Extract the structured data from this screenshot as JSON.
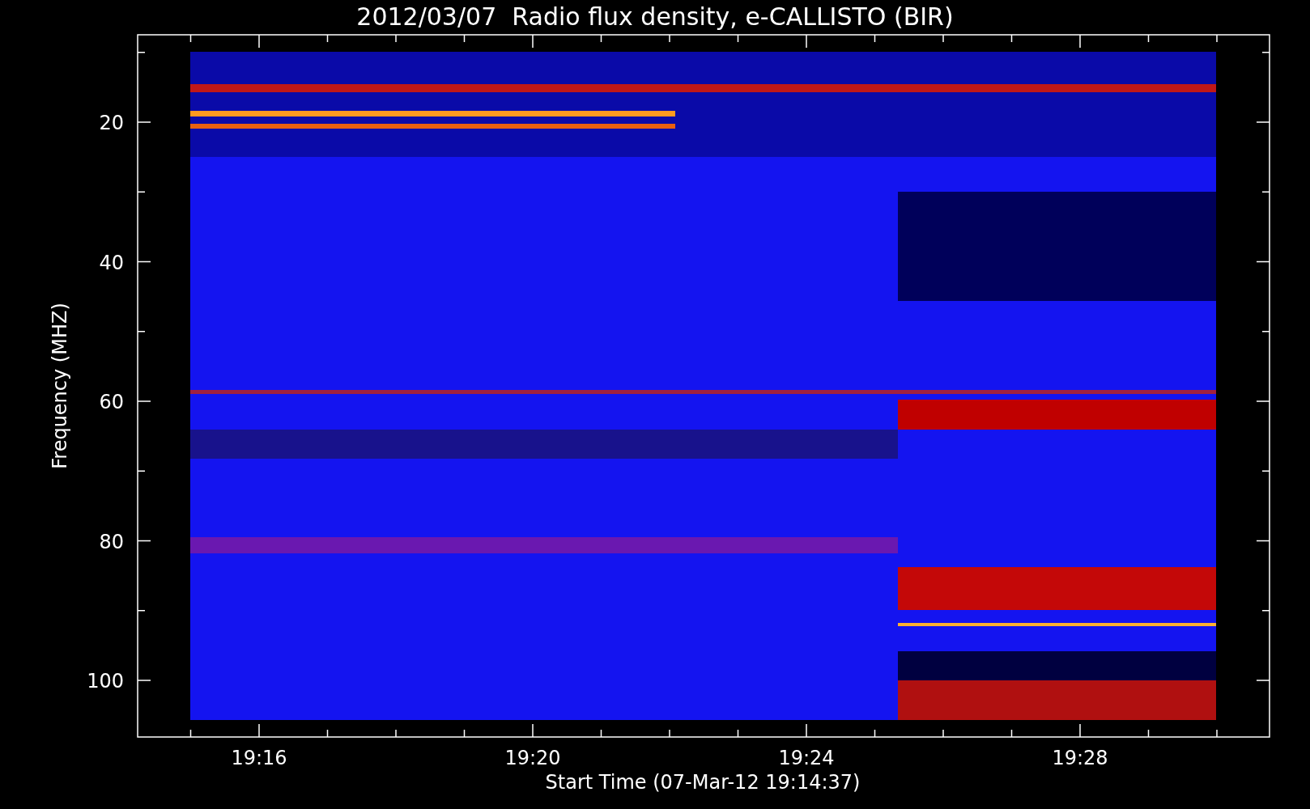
{
  "title": "2012/03/07  Radio flux density, e-CALLISTO (BIR)",
  "y_axis": {
    "label": "Frequency (MHZ)",
    "ticks": [
      "20",
      "40",
      "60",
      "80",
      "100"
    ]
  },
  "x_axis": {
    "label": "Start Time (07-Mar-12 19:14:37)",
    "ticks": [
      "19:16",
      "19:20",
      "19:24",
      "19:28"
    ]
  }
}
